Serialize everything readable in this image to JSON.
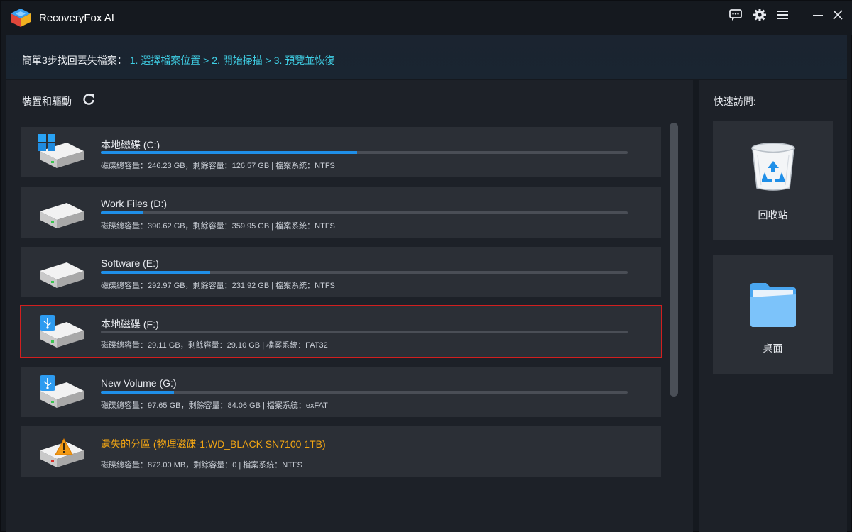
{
  "app": {
    "title": "RecoveryFox AI"
  },
  "titlebar": {
    "icons": [
      "feedback-icon",
      "settings-gear-icon",
      "menu-icon",
      "minimize-icon",
      "close-icon"
    ]
  },
  "steps": {
    "prefix": "簡單3步找回丟失檔案：",
    "link": "1. 選擇檔案位置 > 2. 開始掃描 > 3. 預覽並恢復"
  },
  "devices": {
    "title": "裝置和驅動",
    "drives": [
      {
        "name": "本地磁碟 (C:)",
        "info": "磁碟總容量：246.23 GB，剩餘容量：126.57 GB | 檔案系統：NTFS",
        "used_fraction": 0.486,
        "icon": "windows-drive-icon"
      },
      {
        "name": "Work Files (D:)",
        "info": "磁碟總容量：390.62 GB，剩餘容量：359.95 GB | 檔案系統：NTFS",
        "used_fraction": 0.079,
        "icon": "hard-drive-icon"
      },
      {
        "name": "Software (E:)",
        "info": "磁碟總容量：292.97 GB，剩餘容量：231.92 GB | 檔案系統：NTFS",
        "used_fraction": 0.208,
        "icon": "hard-drive-icon"
      },
      {
        "name": "本地磁碟 (F:)",
        "info": "磁碟總容量：29.11 GB，剩餘容量：29.10 GB | 檔案系統：FAT32",
        "used_fraction": 0.0,
        "icon": "usb-drive-icon"
      },
      {
        "name": "New Volume (G:)",
        "info": "磁碟總容量：97.65 GB，剩餘容量：84.06 GB | 檔案系統：exFAT",
        "used_fraction": 0.139,
        "icon": "usb-drive-icon"
      },
      {
        "name": "遺失的分區 (物理磁碟-1:WD_BLACK SN7100 1TB)",
        "info": "磁碟總容量：872.00 MB，剩餘容量：0 | 檔案系統：NTFS",
        "used_fraction": null,
        "icon": "lost-partition-warning-icon"
      }
    ]
  },
  "quick_access": {
    "title": "快速訪問:",
    "items": [
      {
        "label": "回收站",
        "icon": "recycle-bin-icon"
      },
      {
        "label": "桌面",
        "icon": "desktop-folder-icon"
      }
    ]
  },
  "colors": {
    "accent": "#1f8fe8",
    "steps_link": "#3fd0e6",
    "lost_partition": "#f1a514",
    "selection": "#d21f1f"
  }
}
